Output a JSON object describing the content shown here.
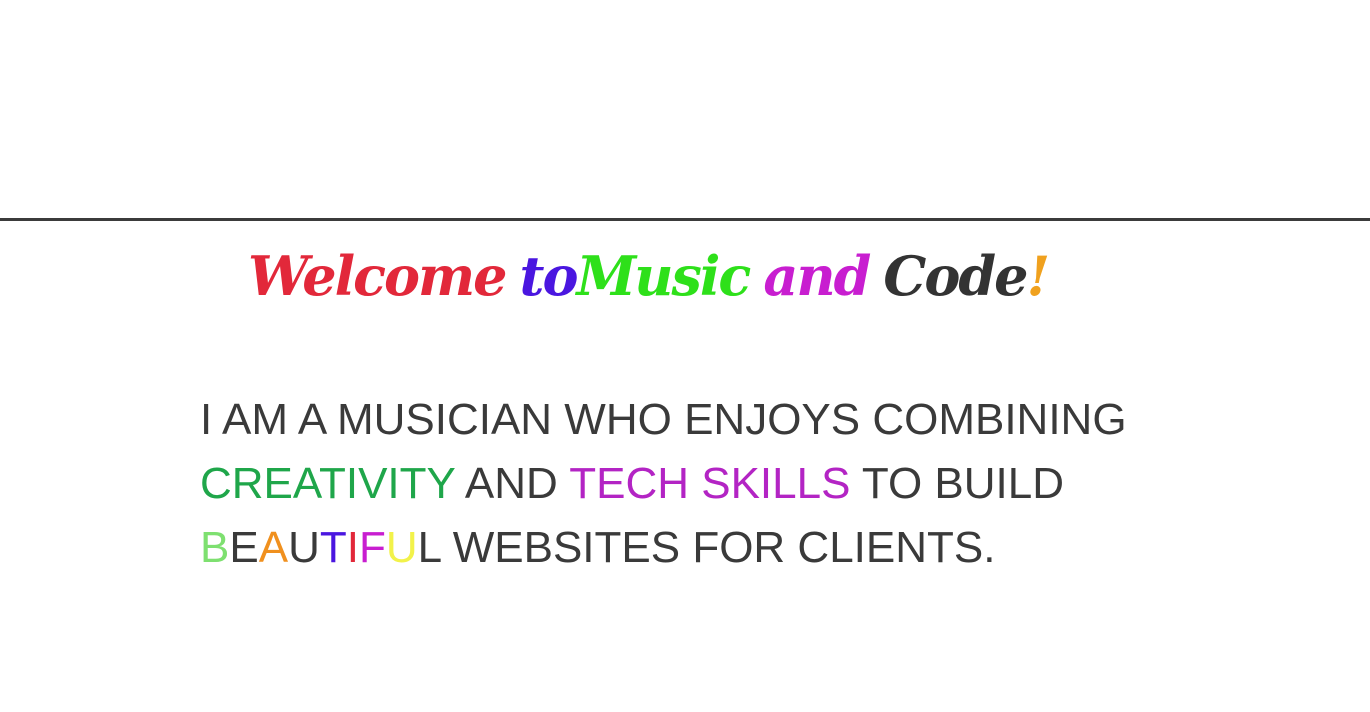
{
  "headline": {
    "words": [
      {
        "text": "Welcome",
        "color": "#e2283a"
      },
      {
        "text": "to",
        "color": "#4a16e0"
      },
      {
        "text": "Music",
        "color": "#2ee01a"
      },
      {
        "text": "and",
        "color": "#c81ed0"
      },
      {
        "text": "Code",
        "color": "#333333"
      },
      {
        "text": "!",
        "color": "#f0a11e"
      }
    ]
  },
  "intro": {
    "line1": "I AM A MUSICIAN WHO ENJOYS COMBINING",
    "line2_highlight1": "CREATIVITY",
    "line2_mid": " AND ",
    "line2_highlight2": "TECH SKILLS",
    "line2_end": " TO BUILD",
    "beautiful_letters": [
      {
        "ch": "B",
        "color": "#7ee070"
      },
      {
        "ch": "E",
        "color": "#3a3a3a"
      },
      {
        "ch": "A",
        "color": "#f0901e"
      },
      {
        "ch": "U",
        "color": "#3a3a3a"
      },
      {
        "ch": "T",
        "color": "#4a16e0"
      },
      {
        "ch": "I",
        "color": "#e2283a"
      },
      {
        "ch": "F",
        "color": "#c81ed0"
      },
      {
        "ch": "U",
        "color": "#f2f24a"
      },
      {
        "ch": "L",
        "color": "#3a3a3a"
      }
    ],
    "line3_rest": " WEBSITES FOR CLIENTS."
  }
}
